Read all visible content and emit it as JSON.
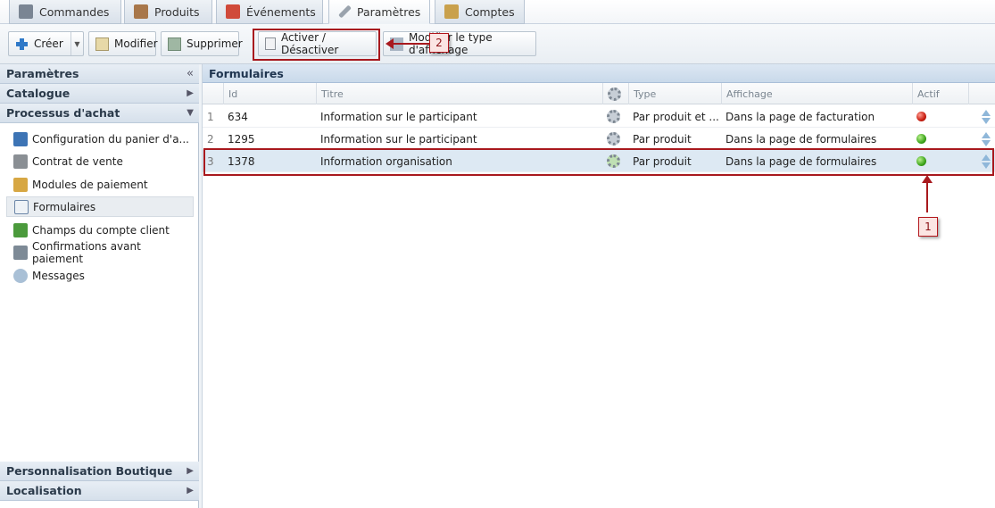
{
  "tabs": [
    {
      "label": "Commandes",
      "icon": "orders-icon",
      "active": false
    },
    {
      "label": "Produits",
      "icon": "products-icon",
      "active": false
    },
    {
      "label": "Événements",
      "icon": "events-icon",
      "active": false
    },
    {
      "label": "Paramètres",
      "icon": "settings-icon",
      "active": true
    },
    {
      "label": "Comptes",
      "icon": "accounts-icon",
      "active": false
    }
  ],
  "toolbar": {
    "create_label": "Créer",
    "edit_label": "Modifier",
    "delete_label": "Supprimer",
    "toggle_label": "Activer / Désactiver",
    "display_type_label": "Modifier le type d'affichage"
  },
  "annotations": {
    "marker_1": "1",
    "marker_2": "2",
    "accent_color": "#a8191e"
  },
  "sidebar": {
    "title": "Paramètres",
    "collapse_glyph": "«",
    "sections": [
      {
        "label": "Catalogue",
        "arrow": "▶"
      },
      {
        "label": "Processus d'achat",
        "arrow": "▼"
      }
    ],
    "items": [
      {
        "label": "Configuration du panier d'a..."
      },
      {
        "label": "Contrat de vente"
      },
      {
        "label": "Modules de paiement"
      },
      {
        "label": "Formulaires"
      },
      {
        "label": "Champs du compte client"
      },
      {
        "label": "Confirmations avant paiement"
      },
      {
        "label": "Messages"
      }
    ],
    "bottom_sections": [
      {
        "label": "Personnalisation Boutique",
        "arrow": "▶"
      },
      {
        "label": "Localisation",
        "arrow": "▶"
      }
    ]
  },
  "grid": {
    "title": "Formulaires",
    "columns": {
      "id": "Id",
      "title": "Titre",
      "type": "Type",
      "display": "Affichage",
      "active": "Actif"
    },
    "rows": [
      {
        "num": "1",
        "id": "634",
        "title": "Information sur le participant",
        "type": "Par produit et ...",
        "display": "Dans la page de facturation",
        "active": "red"
      },
      {
        "num": "2",
        "id": "1295",
        "title": "Information sur le participant",
        "type": "Par produit",
        "display": "Dans la page de formulaires",
        "active": "green"
      },
      {
        "num": "3",
        "id": "1378",
        "title": "Information organisation",
        "type": "Par produit",
        "display": "Dans la page de formulaires",
        "active": "green"
      }
    ]
  }
}
